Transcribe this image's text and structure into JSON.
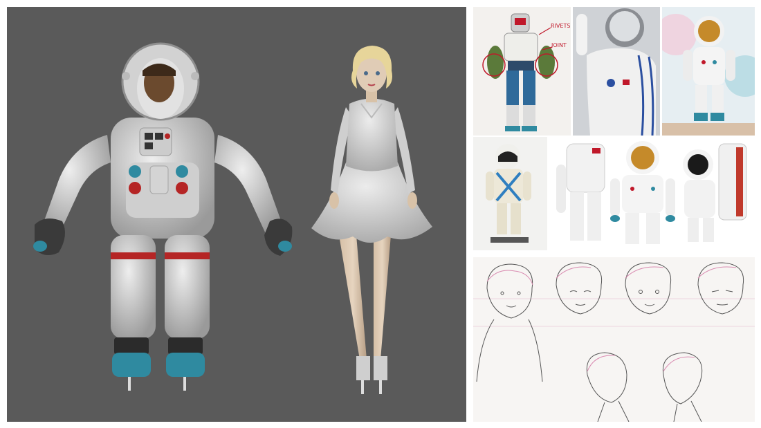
{
  "viewport": {
    "background": "#5a5a5a",
    "characters": [
      "astronaut-model",
      "woman-model"
    ]
  },
  "references": {
    "ref_1": {
      "annotations": [
        "RIVETS",
        "JOINT"
      ],
      "annotation_color": "#c0182a"
    },
    "ref_2": {},
    "ref_3": {},
    "ref_4": {},
    "ref_5": {}
  },
  "sketch": {
    "paper_color": "#f7f5f3",
    "line_color": "#d98ab0"
  },
  "colors": {
    "suit": "#d9d9d9",
    "suit_shadow": "#a8a8a8",
    "stripe": "#b52525",
    "teal": "#2f8aa0",
    "dress": "#d6d6d6",
    "hair": "#e7d59a",
    "skin": "#d8c2a8"
  }
}
